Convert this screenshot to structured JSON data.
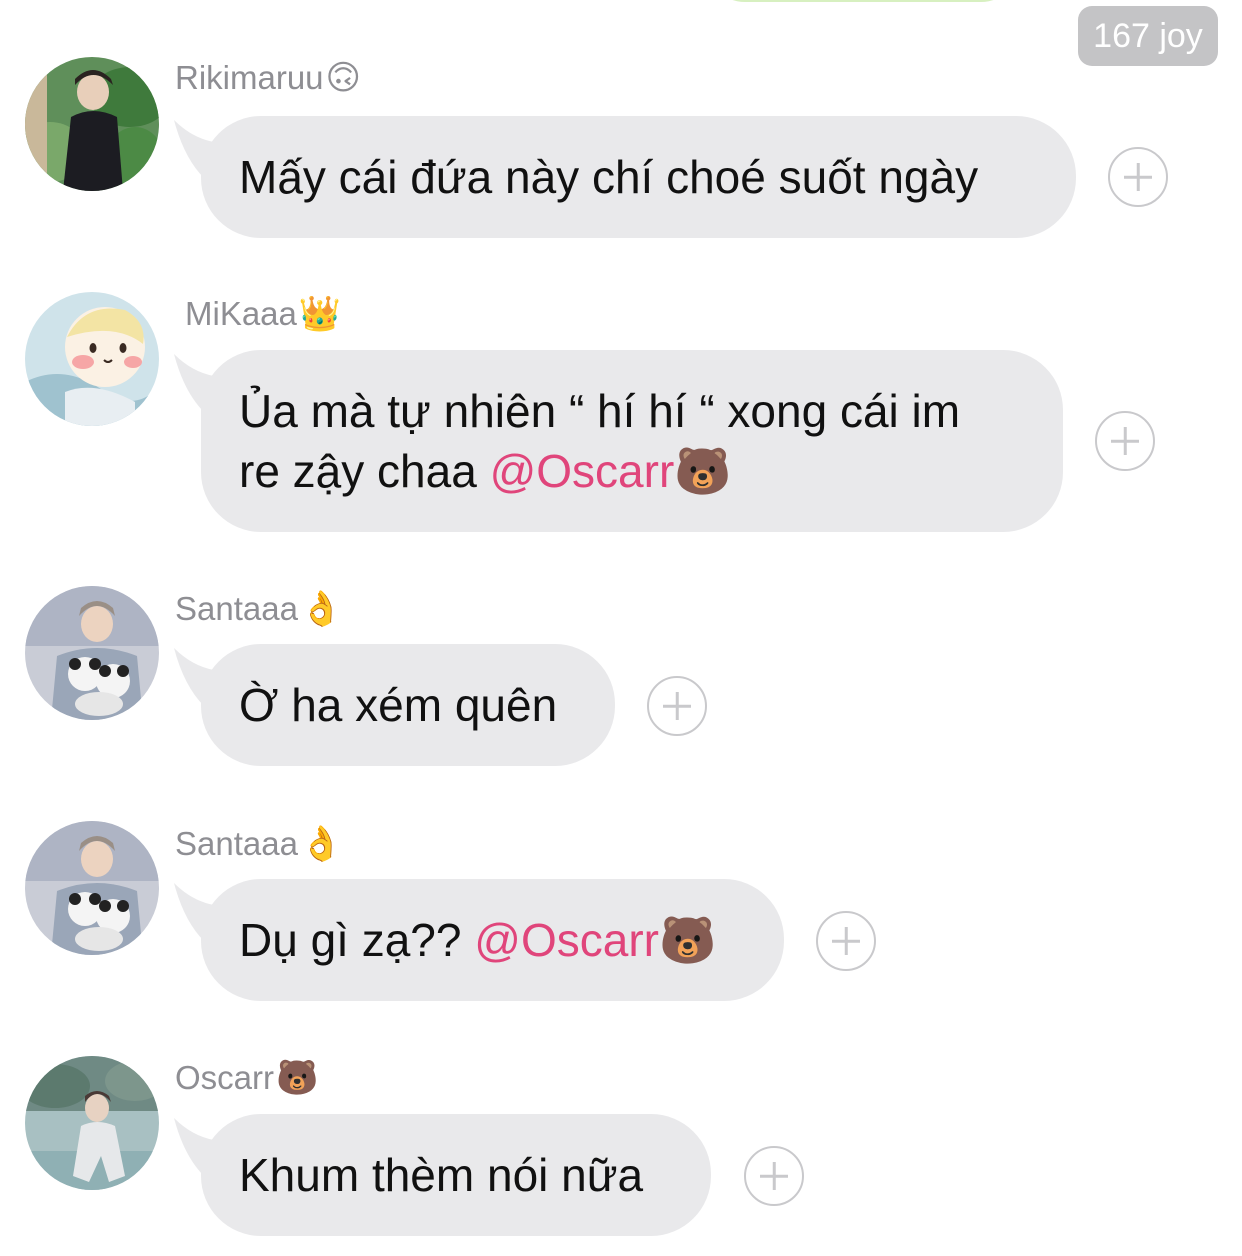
{
  "header": {
    "reaction_badge": "167 joy"
  },
  "messages": [
    {
      "sender": "Rikimaruu",
      "sender_emoji": "🙃",
      "text": "Mấy cái đứa này chí choé suốt ngày",
      "text_line2": "",
      "mention": "",
      "trail_emoji": ""
    },
    {
      "sender": "MiKaaa",
      "sender_emoji": "👑",
      "text": "Ủa mà tự nhiên “ hí hí “ xong cái im",
      "text_line2": "re zậy chaa ",
      "mention": "@Oscarr",
      "trail_emoji": "🐻"
    },
    {
      "sender": "Santaaa",
      "sender_emoji": "👌",
      "text": "Ờ ha xém quên",
      "text_line2": "",
      "mention": "",
      "trail_emoji": ""
    },
    {
      "sender": "Santaaa",
      "sender_emoji": "👌",
      "text": "Dụ gì zạ?? ",
      "text_line2": "",
      "mention": "@Oscarr",
      "trail_emoji": "🐻"
    },
    {
      "sender": "Oscarr",
      "sender_emoji": "🐻",
      "text": "Khum thèm nói nữa",
      "text_line2": "",
      "mention": "",
      "trail_emoji": ""
    }
  ],
  "colors": {
    "bubble": "#e9e9eb",
    "mention": "#e0457b",
    "name": "#8e8e93",
    "badge": "#c4c4c6"
  },
  "icons": {
    "add_reaction": "plus-circle-icon"
  }
}
